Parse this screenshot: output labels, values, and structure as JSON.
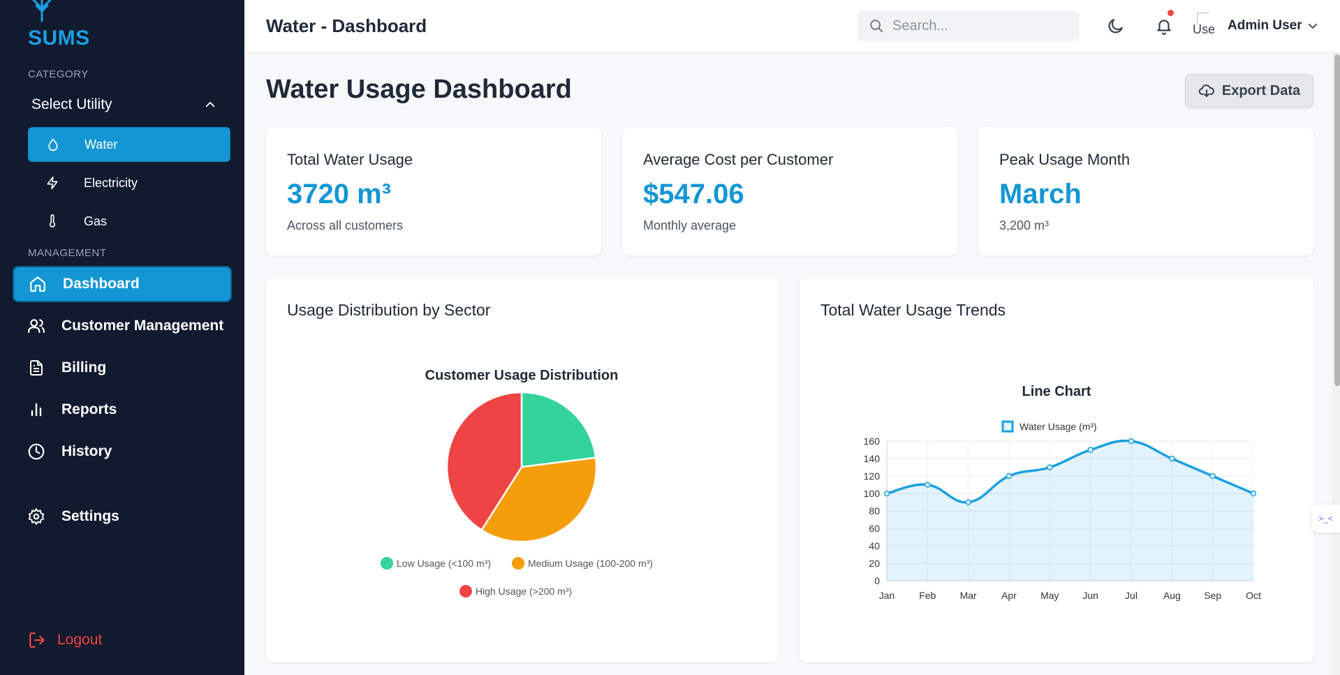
{
  "app": {
    "name": "SUMS"
  },
  "sidebar": {
    "category_label": "CATEGORY",
    "select_utility": "Select Utility",
    "utilities": [
      {
        "label": "Water",
        "icon": "droplet-icon",
        "active": true
      },
      {
        "label": "Electricity",
        "icon": "zap-icon",
        "active": false
      },
      {
        "label": "Gas",
        "icon": "thermometer-icon",
        "active": false
      }
    ],
    "management_label": "MANAGEMENT",
    "nav": [
      {
        "label": "Dashboard",
        "icon": "home-icon",
        "active": true
      },
      {
        "label": "Customer Management",
        "icon": "users-icon",
        "active": false
      },
      {
        "label": "Billing",
        "icon": "file-text-icon",
        "active": false
      },
      {
        "label": "Reports",
        "icon": "bar-chart-icon",
        "active": false
      },
      {
        "label": "History",
        "icon": "clock-icon",
        "active": false
      },
      {
        "label": "Settings",
        "icon": "gear-icon",
        "active": false
      }
    ],
    "logout": "Logout"
  },
  "header": {
    "title": "Water - Dashboard",
    "search_placeholder": "Search...",
    "avatar_alt": "Use",
    "user_name": "Admin User"
  },
  "main": {
    "title": "Water Usage Dashboard",
    "export_label": "Export Data",
    "stats": [
      {
        "label": "Total Water Usage",
        "value": "3720 m³",
        "sub": "Across all customers"
      },
      {
        "label": "Average Cost per Customer",
        "value": "$547.06",
        "sub": "Monthly average"
      },
      {
        "label": "Peak Usage Month",
        "value": "March",
        "sub": "3,200 m³"
      }
    ],
    "pie_card_title": "Usage Distribution by Sector",
    "line_card_title": "Total Water Usage Trends",
    "side_tab": ">_<"
  },
  "colors": {
    "accent": "#1496d4",
    "sidebar": "#111a2e",
    "logout": "#ef4444"
  },
  "chart_data": [
    {
      "type": "pie",
      "title": "Customer Usage Distribution",
      "categories": [
        "Low Usage (<100 m³)",
        "Medium Usage (100-200 m³)",
        "High Usage (>200 m³)"
      ],
      "values": [
        23,
        36,
        41
      ],
      "colors": [
        "#34d399",
        "#f59e0b",
        "#ef4444"
      ],
      "legend": "bottom"
    },
    {
      "type": "area",
      "title": "Line Chart",
      "categories": [
        "Jan",
        "Feb",
        "Mar",
        "Apr",
        "May",
        "Jun",
        "Jul",
        "Aug",
        "Sep",
        "Oct"
      ],
      "series": [
        {
          "name": "Water Usage (m³)",
          "values": [
            100,
            110,
            90,
            120,
            130,
            150,
            160,
            140,
            120,
            100
          ]
        }
      ],
      "yticks": [
        0,
        20,
        40,
        60,
        80,
        100,
        120,
        140,
        160
      ],
      "ylim": [
        0,
        160
      ],
      "grid": true,
      "legend": "top",
      "color": "#1aa0e0"
    }
  ]
}
